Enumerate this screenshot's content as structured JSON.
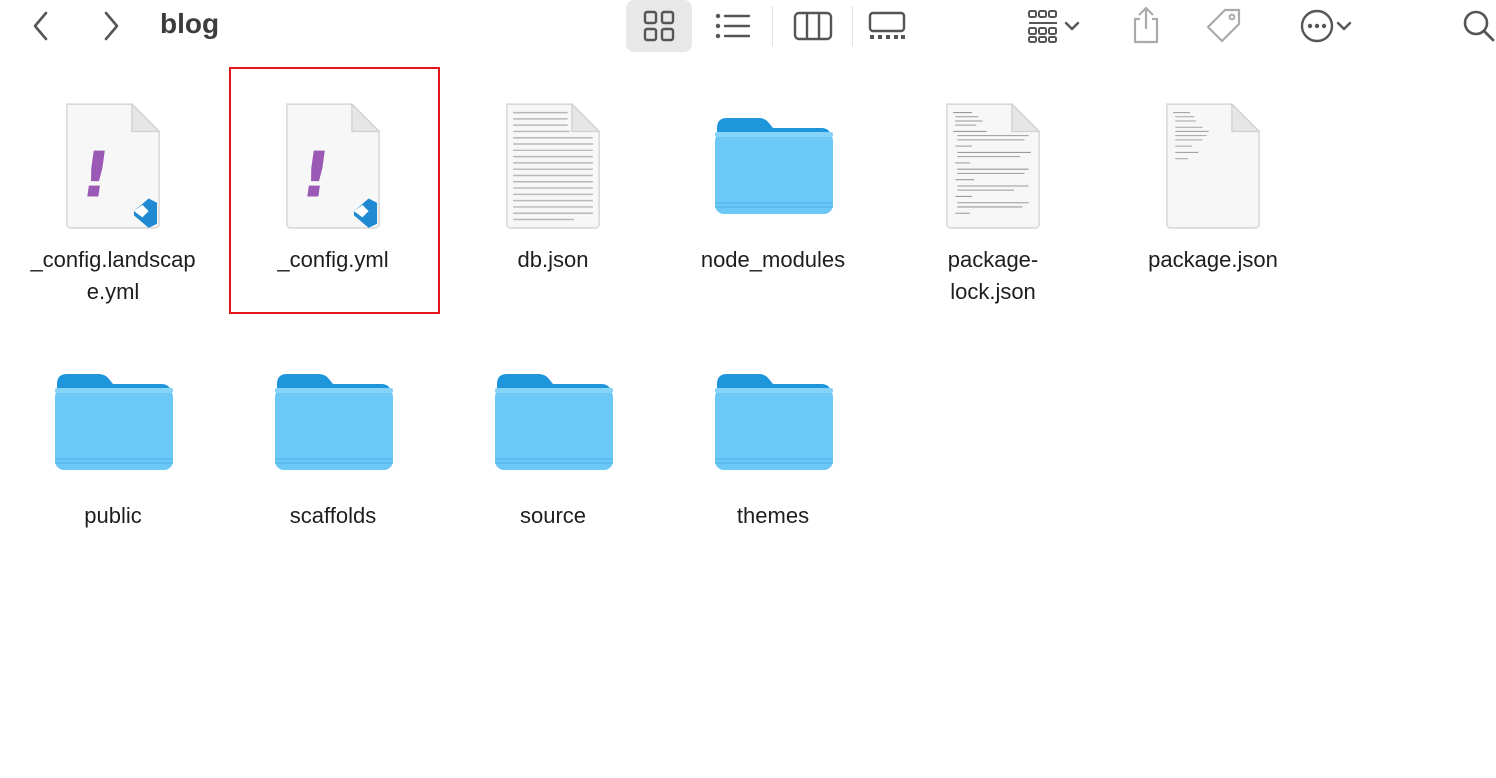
{
  "window": {
    "title": "blog"
  },
  "toolbar": {
    "back_icon": "chevron-left-icon",
    "forward_icon": "chevron-right-icon",
    "view_modes": [
      "icon-view",
      "list-view",
      "column-view",
      "gallery-view"
    ],
    "active_view": "icon-view",
    "actions": [
      "group-icon",
      "share-icon",
      "tag-icon",
      "more-icon",
      "search-icon"
    ]
  },
  "files": [
    {
      "name": "_config.landscape e.yml",
      "display": "_config.landscap e.yml",
      "kind": "yaml"
    },
    {
      "name": "_config.yml",
      "kind": "yaml",
      "selected_highlight": true
    },
    {
      "name": "db.json",
      "kind": "json-dense"
    },
    {
      "name": "node_modules",
      "kind": "folder"
    },
    {
      "name": "package-lock.json",
      "display": "package- lock.json",
      "kind": "json-doc"
    },
    {
      "name": "package.json",
      "kind": "json-doc-light"
    },
    {
      "name": "public",
      "kind": "folder"
    },
    {
      "name": "scaffolds",
      "kind": "folder"
    },
    {
      "name": "source",
      "kind": "folder"
    },
    {
      "name": "themes",
      "kind": "folder"
    }
  ],
  "labels": {
    "f0": "_config.landscap\ne.yml",
    "f1": "_config.yml",
    "f2": "db.json",
    "f3": "node_modules",
    "f4": "package-\nlock.json",
    "f5": "package.json",
    "f6": "public",
    "f7": "scaffolds",
    "f8": "source",
    "f9": "themes"
  },
  "colors": {
    "folder_body": "#6cc8f7",
    "folder_tab": "#1f95dc",
    "highlight": "#e3161b",
    "yaml_mark": "#9b59b6",
    "vscode": "#1f8ad2"
  }
}
